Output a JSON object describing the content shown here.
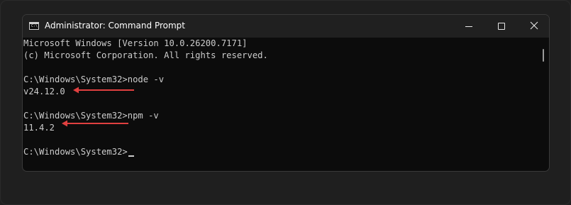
{
  "window": {
    "title": "Administrator: Command Prompt",
    "app_icon_text": "C:\\",
    "icon_names": [
      "cmd-app-icon",
      "minimize-icon",
      "maximize-icon",
      "close-icon"
    ]
  },
  "terminal": {
    "lines": [
      "Microsoft Windows [Version 10.0.26200.7171]",
      "(c) Microsoft Corporation. All rights reserved.",
      "",
      "C:\\Windows\\System32>node -v",
      "v24.12.0",
      "",
      "C:\\Windows\\System32>npm -v",
      "11.4.2",
      "",
      "C:\\Windows\\System32>"
    ]
  },
  "colors": {
    "terminal_bg": "#0c0c0c",
    "titlebar_bg": "#202020",
    "text": "#cccccc",
    "annotation_arrow": "#e04040"
  }
}
